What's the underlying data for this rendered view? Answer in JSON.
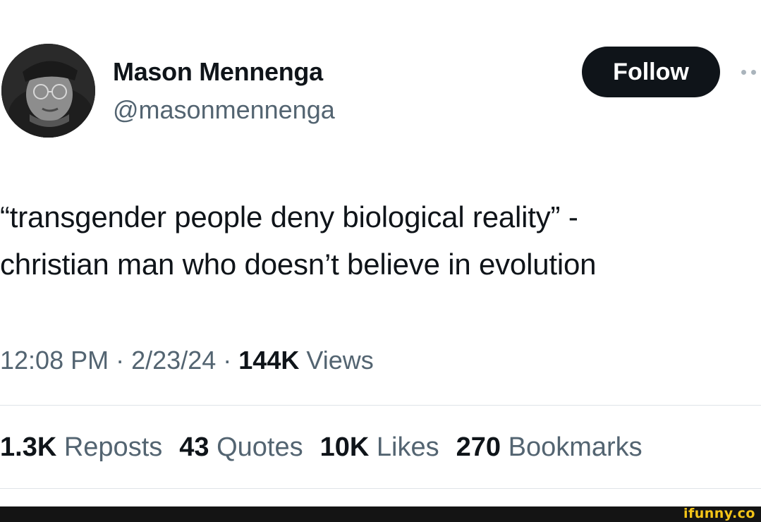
{
  "author": {
    "name": "Mason Mennenga",
    "handle": "@masonmennenga"
  },
  "follow_button": {
    "label": "Follow"
  },
  "tweet": {
    "lines": [
      "“transgender people deny biological reality” -",
      "christian man who doesn’t believe in evolution"
    ]
  },
  "meta": {
    "time": "12:08 PM",
    "separator": "·",
    "date": "2/23/24",
    "views_count": "144K",
    "views_label": "Views"
  },
  "stats": [
    {
      "count": "1.3K",
      "label": "Reposts"
    },
    {
      "count": "43",
      "label": "Quotes"
    },
    {
      "count": "10K",
      "label": "Likes"
    },
    {
      "count": "270",
      "label": "Bookmarks"
    }
  ],
  "watermark": {
    "text": "ifunny.co"
  },
  "colors": {
    "text_primary": "#0f1419",
    "text_secondary": "#536471",
    "button_bg": "#0f1419",
    "divider": "#dfe4e8",
    "watermark": "#f5c518"
  }
}
